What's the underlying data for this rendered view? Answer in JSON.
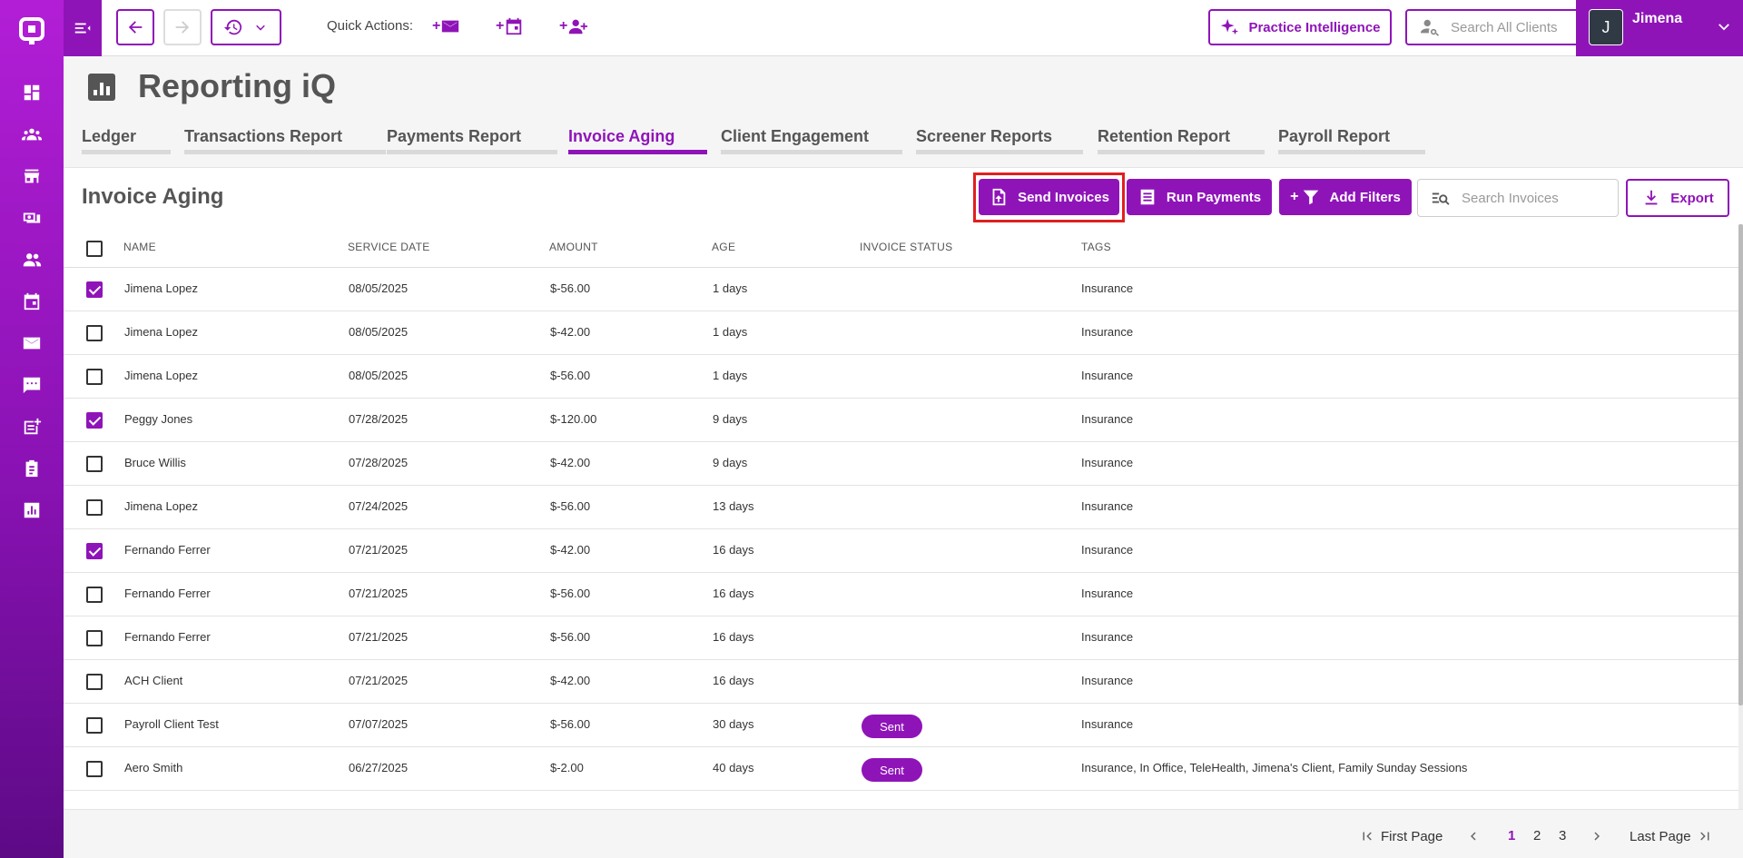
{
  "quick_actions": {
    "label": "Quick Actions:",
    "plus": "+"
  },
  "header": {
    "practice_intelligence": "Practice Intelligence",
    "search_clients_placeholder": "Search All Clients",
    "user_initial": "J",
    "user_name": "Jimena"
  },
  "page": {
    "title": "Reporting iQ"
  },
  "tabs": [
    {
      "label": "Ledger"
    },
    {
      "label": "Transactions Report"
    },
    {
      "label": "Payments Report"
    },
    {
      "label": "Invoice Aging"
    },
    {
      "label": "Client Engagement"
    },
    {
      "label": "Screener Reports"
    },
    {
      "label": "Retention Report"
    },
    {
      "label": "Payroll Report"
    }
  ],
  "section": {
    "title": "Invoice Aging",
    "send_invoices": "Send Invoices",
    "run_payments": "Run Payments",
    "add_filters": "Add Filters",
    "search_placeholder": "Search Invoices",
    "export": "Export"
  },
  "table": {
    "headers": [
      "NAME",
      "SERVICE DATE",
      "AMOUNT",
      "AGE",
      "INVOICE STATUS",
      "TAGS"
    ],
    "rows": [
      {
        "checked": true,
        "name": "Jimena Lopez",
        "date": "08/05/2025",
        "amount": "$-56.00",
        "age": "1 days",
        "status": "",
        "tags": "Insurance"
      },
      {
        "checked": false,
        "name": "Jimena Lopez",
        "date": "08/05/2025",
        "amount": "$-42.00",
        "age": "1 days",
        "status": "",
        "tags": "Insurance"
      },
      {
        "checked": false,
        "name": "Jimena Lopez",
        "date": "08/05/2025",
        "amount": "$-56.00",
        "age": "1 days",
        "status": "",
        "tags": "Insurance"
      },
      {
        "checked": true,
        "name": "Peggy Jones",
        "date": "07/28/2025",
        "amount": "$-120.00",
        "age": "9 days",
        "status": "",
        "tags": "Insurance"
      },
      {
        "checked": false,
        "name": "Bruce Willis",
        "date": "07/28/2025",
        "amount": "$-42.00",
        "age": "9 days",
        "status": "",
        "tags": "Insurance"
      },
      {
        "checked": false,
        "name": "Jimena Lopez",
        "date": "07/24/2025",
        "amount": "$-56.00",
        "age": "13 days",
        "status": "",
        "tags": "Insurance"
      },
      {
        "checked": true,
        "name": "Fernando Ferrer",
        "date": "07/21/2025",
        "amount": "$-42.00",
        "age": "16 days",
        "status": "",
        "tags": "Insurance"
      },
      {
        "checked": false,
        "name": "Fernando Ferrer",
        "date": "07/21/2025",
        "amount": "$-56.00",
        "age": "16 days",
        "status": "",
        "tags": "Insurance"
      },
      {
        "checked": false,
        "name": "Fernando Ferrer",
        "date": "07/21/2025",
        "amount": "$-56.00",
        "age": "16 days",
        "status": "",
        "tags": "Insurance"
      },
      {
        "checked": false,
        "name": "ACH Client",
        "date": "07/21/2025",
        "amount": "$-42.00",
        "age": "16 days",
        "status": "",
        "tags": "Insurance"
      },
      {
        "checked": false,
        "name": "Payroll Client Test",
        "date": "07/07/2025",
        "amount": "$-56.00",
        "age": "30 days",
        "status": "Sent",
        "tags": "Insurance"
      },
      {
        "checked": false,
        "name": "Aero Smith",
        "date": "06/27/2025",
        "amount": "$-2.00",
        "age": "40 days",
        "status": "Sent",
        "tags": "Insurance, In Office, TeleHealth, Jimena's Client, Family Sunday Sessions"
      }
    ]
  },
  "pagination": {
    "first": "First Page",
    "pages": [
      "1",
      "2",
      "3"
    ],
    "current": "1",
    "last": "Last Page"
  },
  "colors": {
    "brand": "#8f14b8",
    "highlight": "#e02020"
  }
}
